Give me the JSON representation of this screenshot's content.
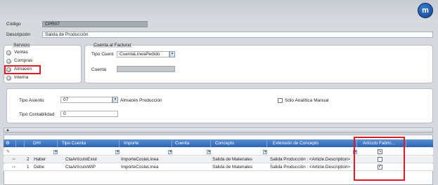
{
  "header": {
    "codigo_label": "Código",
    "codigo_value": "CPR07",
    "descripcion_label": "Descripción",
    "descripcion_value": "Salida de Producción"
  },
  "servicio": {
    "legend": "Servicio",
    "options": [
      {
        "label": "Ventas",
        "selected": false
      },
      {
        "label": "Compras",
        "selected": false
      },
      {
        "label": "Almacén",
        "selected": true
      },
      {
        "label": "Interna",
        "selected": false
      }
    ]
  },
  "cuenta_facturar": {
    "legend": "Cuenta al Facturar",
    "tipo_label": "Tipo Cuent",
    "tipo_value": "CuentaLíneaPedido",
    "cuenta_label": "Cuenta",
    "cuenta_value": ""
  },
  "asiento": {
    "tipo_asiento_label": "Tipo Asiento",
    "tipo_asiento_value": "07",
    "tipo_asiento_desc": "Almacén Producción",
    "solo_analitica_label": "Sólo Analítica Manual",
    "solo_analitica_checked": false,
    "tipo_contabilidad_label": "Tipo Contabilidad",
    "tipo_contabilidad_value": "0"
  },
  "grid": {
    "columns": [
      "D/H",
      "Tipo Cuenta",
      "Importe",
      "Cuenta",
      "Concepto",
      "Extensión de Concepto",
      "Artículo Fabric..."
    ],
    "rows": [
      {
        "num": "2",
        "dh": "Haber",
        "tipo_cuenta": "CtaArtículoExist",
        "importe": "ImporteCosteLínea",
        "cuenta": "",
        "concepto": "Salida de Materiales",
        "extension": "Salida Producción : <Article.Description>",
        "articulo": false
      },
      {
        "num": "1",
        "dh": "Debe",
        "tipo_cuenta": "CtaArtículoWIP",
        "importe": "ImporteCosteLínea",
        "cuenta": "",
        "concepto": "Salida de Materiales",
        "extension": "Salida Producción : <Article.Description>",
        "articulo": true
      }
    ]
  },
  "colors": {
    "accent": "#2b63b4",
    "highlight": "#e01b24"
  }
}
